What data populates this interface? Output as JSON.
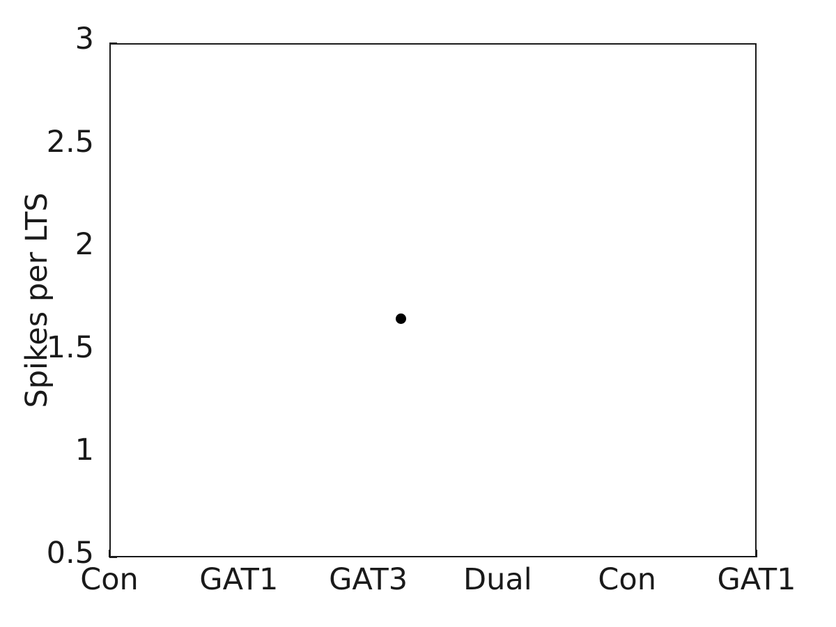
{
  "chart_data": {
    "type": "scatter",
    "title": "",
    "xlabel": "",
    "ylabel": "Spikes per LTS",
    "categories": [
      "Con",
      "GAT1",
      "GAT3",
      "Dual",
      "Con",
      "GAT1"
    ],
    "xtick_labels": [
      "Con",
      "GAT1",
      "GAT3",
      "Dual",
      "Con",
      "GAT1"
    ],
    "ytick_labels": [
      "0.5",
      "1",
      "1.5",
      "2",
      "2.5",
      "3"
    ],
    "ytick_values": [
      0.5,
      1,
      1.5,
      2,
      2.5,
      3
    ],
    "ylim": [
      0.5,
      3
    ],
    "xlim": [
      0,
      5
    ],
    "grid": false,
    "legend": null,
    "marker_color": "#000000",
    "marker_shape": "circle",
    "axis_color": "#1a1a1a",
    "background_color": "#ffffff",
    "points": [
      {
        "x": 2.24,
        "y": 1.667,
        "category": "GAT3"
      }
    ]
  }
}
